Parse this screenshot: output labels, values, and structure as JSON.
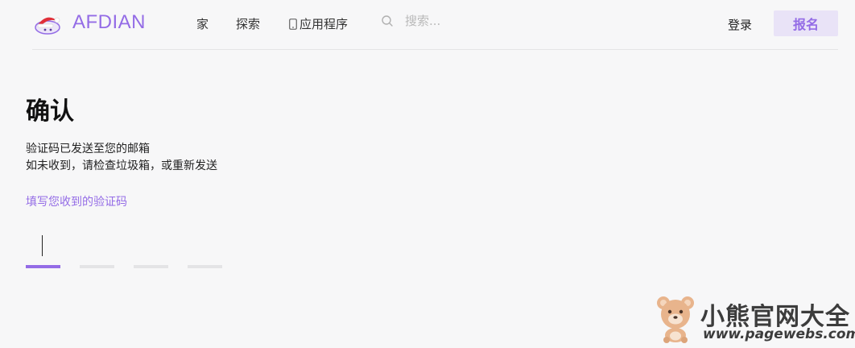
{
  "brand": {
    "name": "AFDIAN",
    "color": "#946ce6",
    "logo_icon": "afdian-logo-icon"
  },
  "nav": {
    "items": [
      {
        "label": "家"
      },
      {
        "label": "探索"
      },
      {
        "label": "应用程序",
        "icon": "phone-icon"
      }
    ]
  },
  "search": {
    "placeholder": "搜索...",
    "value": "",
    "icon": "search-icon"
  },
  "auth": {
    "login_label": "登录",
    "signup_label": "报名"
  },
  "main": {
    "title": "确认",
    "info_lines": [
      "验证码已发送至您的邮箱",
      "如未收到，请检查垃圾箱，或重新发送"
    ],
    "code_label": "填写您收到的验证码",
    "code_digits": [
      "",
      "",
      "",
      ""
    ],
    "active_digit_index": 0
  },
  "watermark": {
    "title": "小熊官网大全",
    "url": "www.pagewebs.com",
    "icon": "bear-mascot-icon"
  },
  "colors": {
    "accent": "#946ce6",
    "accent_light": "#e9e3f7",
    "background": "#f7f7f8",
    "divider": "#e4e4e6"
  }
}
